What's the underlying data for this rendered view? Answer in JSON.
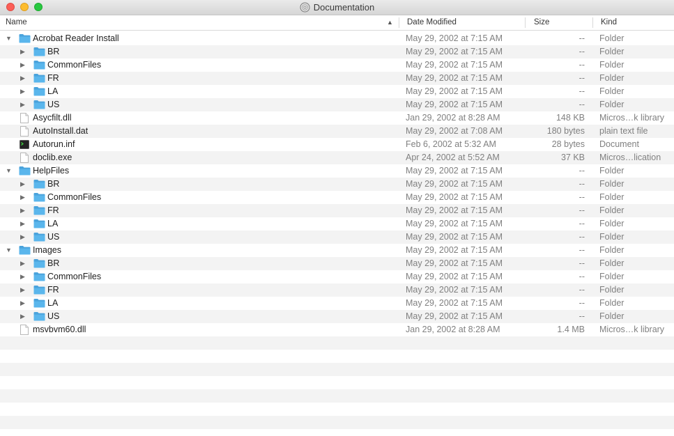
{
  "window": {
    "title": "Documentation"
  },
  "columns": {
    "name": "Name",
    "date": "Date Modified",
    "size": "Size",
    "kind": "Kind"
  },
  "rows": [
    {
      "level": 0,
      "disclosure": "open",
      "icon": "folder",
      "name": "Acrobat Reader Install",
      "date": "May 29, 2002 at 7:15 AM",
      "size": "--",
      "kind": "Folder"
    },
    {
      "level": 1,
      "disclosure": "closed",
      "icon": "folder",
      "name": "BR",
      "date": "May 29, 2002 at 7:15 AM",
      "size": "--",
      "kind": "Folder"
    },
    {
      "level": 1,
      "disclosure": "closed",
      "icon": "folder",
      "name": "CommonFiles",
      "date": "May 29, 2002 at 7:15 AM",
      "size": "--",
      "kind": "Folder"
    },
    {
      "level": 1,
      "disclosure": "closed",
      "icon": "folder",
      "name": "FR",
      "date": "May 29, 2002 at 7:15 AM",
      "size": "--",
      "kind": "Folder"
    },
    {
      "level": 1,
      "disclosure": "closed",
      "icon": "folder",
      "name": "LA",
      "date": "May 29, 2002 at 7:15 AM",
      "size": "--",
      "kind": "Folder"
    },
    {
      "level": 1,
      "disclosure": "closed",
      "icon": "folder",
      "name": "US",
      "date": "May 29, 2002 at 7:15 AM",
      "size": "--",
      "kind": "Folder"
    },
    {
      "level": 0,
      "disclosure": "none",
      "icon": "document",
      "name": "Asycfilt.dll",
      "date": "Jan 29, 2002 at 8:28 AM",
      "size": "148 KB",
      "kind": "Micros…k library"
    },
    {
      "level": 0,
      "disclosure": "none",
      "icon": "document",
      "name": "AutoInstall.dat",
      "date": "May 29, 2002 at 7:08 AM",
      "size": "180 bytes",
      "kind": "plain text file"
    },
    {
      "level": 0,
      "disclosure": "none",
      "icon": "terminal",
      "name": "Autorun.inf",
      "date": "Feb 6, 2002 at 5:32 AM",
      "size": "28 bytes",
      "kind": "Document"
    },
    {
      "level": 0,
      "disclosure": "none",
      "icon": "document",
      "name": "doclib.exe",
      "date": "Apr 24, 2002 at 5:52 AM",
      "size": "37 KB",
      "kind": "Micros…lication"
    },
    {
      "level": 0,
      "disclosure": "open",
      "icon": "folder",
      "name": "HelpFiles",
      "date": "May 29, 2002 at 7:15 AM",
      "size": "--",
      "kind": "Folder"
    },
    {
      "level": 1,
      "disclosure": "closed",
      "icon": "folder",
      "name": "BR",
      "date": "May 29, 2002 at 7:15 AM",
      "size": "--",
      "kind": "Folder"
    },
    {
      "level": 1,
      "disclosure": "closed",
      "icon": "folder",
      "name": "CommonFiles",
      "date": "May 29, 2002 at 7:15 AM",
      "size": "--",
      "kind": "Folder"
    },
    {
      "level": 1,
      "disclosure": "closed",
      "icon": "folder",
      "name": "FR",
      "date": "May 29, 2002 at 7:15 AM",
      "size": "--",
      "kind": "Folder"
    },
    {
      "level": 1,
      "disclosure": "closed",
      "icon": "folder",
      "name": "LA",
      "date": "May 29, 2002 at 7:15 AM",
      "size": "--",
      "kind": "Folder"
    },
    {
      "level": 1,
      "disclosure": "closed",
      "icon": "folder",
      "name": "US",
      "date": "May 29, 2002 at 7:15 AM",
      "size": "--",
      "kind": "Folder"
    },
    {
      "level": 0,
      "disclosure": "open",
      "icon": "folder",
      "name": "Images",
      "date": "May 29, 2002 at 7:15 AM",
      "size": "--",
      "kind": "Folder"
    },
    {
      "level": 1,
      "disclosure": "closed",
      "icon": "folder",
      "name": "BR",
      "date": "May 29, 2002 at 7:15 AM",
      "size": "--",
      "kind": "Folder"
    },
    {
      "level": 1,
      "disclosure": "closed",
      "icon": "folder",
      "name": "CommonFiles",
      "date": "May 29, 2002 at 7:15 AM",
      "size": "--",
      "kind": "Folder"
    },
    {
      "level": 1,
      "disclosure": "closed",
      "icon": "folder",
      "name": "FR",
      "date": "May 29, 2002 at 7:15 AM",
      "size": "--",
      "kind": "Folder"
    },
    {
      "level": 1,
      "disclosure": "closed",
      "icon": "folder",
      "name": "LA",
      "date": "May 29, 2002 at 7:15 AM",
      "size": "--",
      "kind": "Folder"
    },
    {
      "level": 1,
      "disclosure": "closed",
      "icon": "folder",
      "name": "US",
      "date": "May 29, 2002 at 7:15 AM",
      "size": "--",
      "kind": "Folder"
    },
    {
      "level": 0,
      "disclosure": "none",
      "icon": "document",
      "name": "msvbvm60.dll",
      "date": "Jan 29, 2002 at 8:28 AM",
      "size": "1.4 MB",
      "kind": "Micros…k library"
    }
  ],
  "colors": {
    "folder": "#5ab6ec",
    "folder_tab": "#4aa3dc",
    "stripe": "#f3f3f3",
    "secondary_text": "#808080"
  }
}
